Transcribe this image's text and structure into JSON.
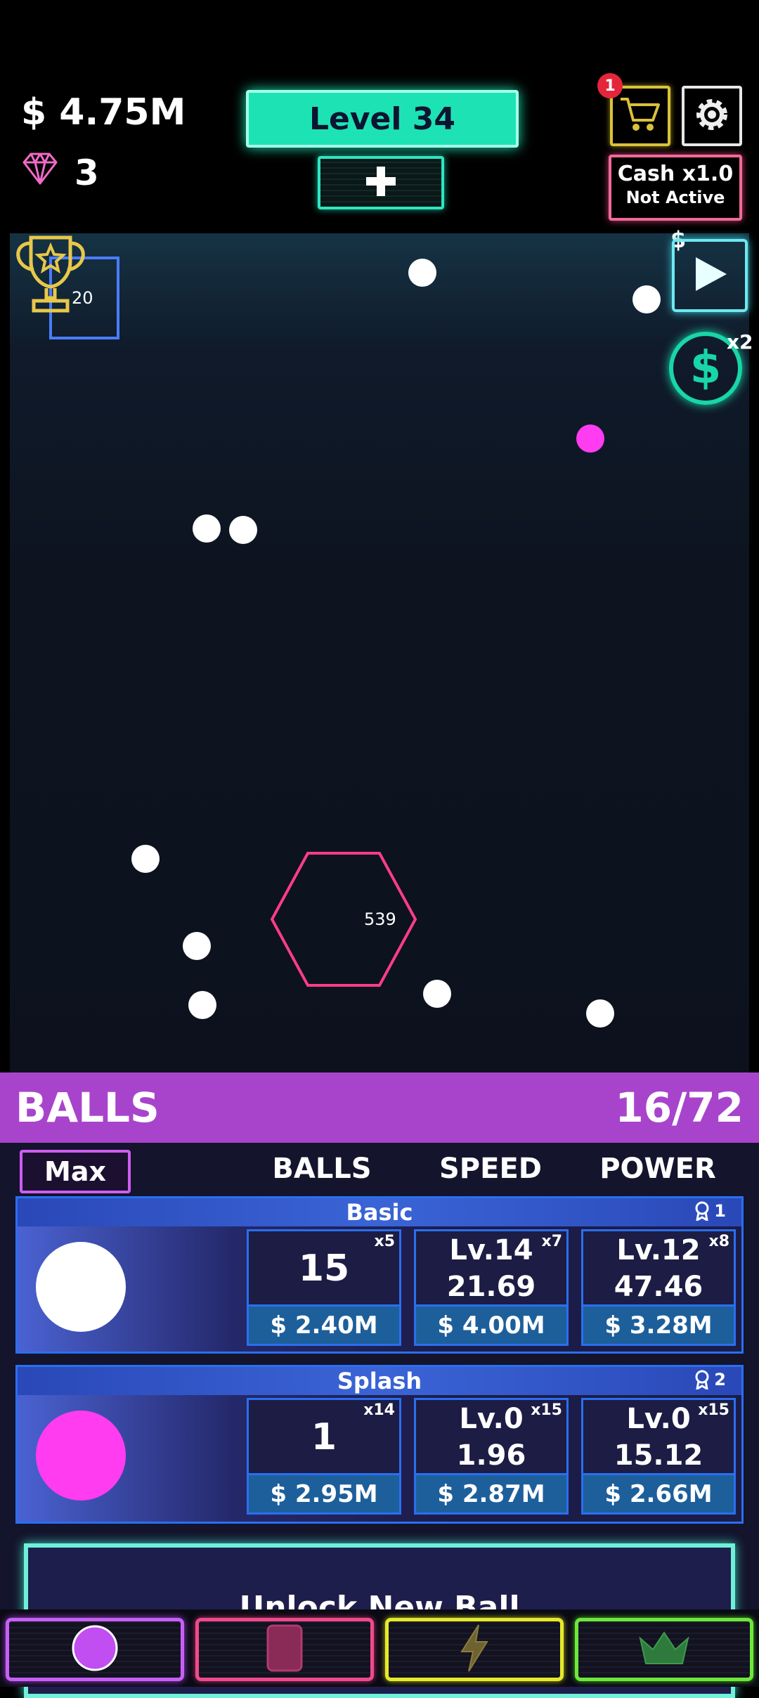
{
  "header": {
    "cash": "$ 4.75M",
    "gems": "3",
    "level": "Level 34",
    "cart_badge": "1",
    "cash_multiplier": "Cash x1.0",
    "cash_multiplier_status": "Not Active"
  },
  "arena": {
    "trophy_box_value": "20",
    "hexagon_value": "539",
    "video_label": "$",
    "bonus_label": "x2",
    "bonus_symbol": "$"
  },
  "panel": {
    "title": "BALLS",
    "count": "16/72",
    "max_label": "Max",
    "columns": [
      "BALLS",
      "SPEED",
      "POWER"
    ],
    "cards": [
      {
        "name": "Basic",
        "rank": "1",
        "color": "#ffffff",
        "balls": {
          "value": "15",
          "mult": "x5",
          "price": "$ 2.40M"
        },
        "speed": {
          "level": "Lv.14",
          "value": "21.69",
          "mult": "x7",
          "price": "$ 4.00M"
        },
        "power": {
          "level": "Lv.12",
          "value": "47.46",
          "mult": "x8",
          "price": "$ 3.28M"
        }
      },
      {
        "name": "Splash",
        "rank": "2",
        "color": "#ff3cf0",
        "balls": {
          "value": "1",
          "mult": "x14",
          "price": "$ 2.95M"
        },
        "speed": {
          "level": "Lv.0",
          "value": "1.96",
          "mult": "x15",
          "price": "$ 2.87M"
        },
        "power": {
          "level": "Lv.0",
          "value": "15.12",
          "mult": "x15",
          "price": "$ 2.66M"
        }
      }
    ],
    "unlock_label": "Unlock New Ball"
  },
  "nav": [
    "balls-tab",
    "cards-tab",
    "boost-tab",
    "crown-tab"
  ],
  "colors": {
    "accent": "#1de3b4",
    "panel_header": "#a844cc",
    "splash_ball": "#ff3cf0"
  }
}
